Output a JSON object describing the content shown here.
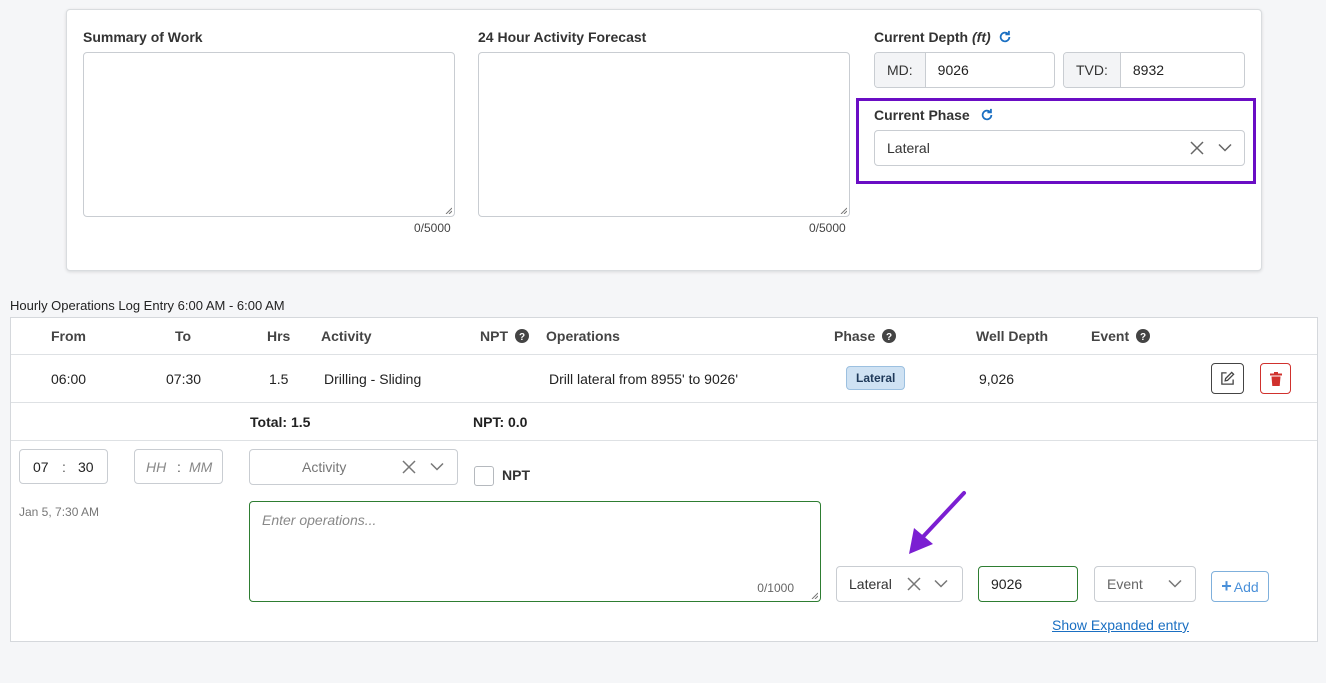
{
  "summary": {
    "label": "Summary of Work",
    "counter": "0/5000"
  },
  "forecast": {
    "label": "24 Hour Activity Forecast",
    "counter": "0/5000"
  },
  "depth": {
    "label": "Current Depth",
    "unit": "(ft)",
    "md_label": "MD:",
    "md_value": "9026",
    "tvd_label": "TVD:",
    "tvd_value": "8932"
  },
  "phase": {
    "label": "Current Phase",
    "value": "Lateral"
  },
  "log": {
    "title": "Hourly Operations Log Entry 6:00 AM - 6:00 AM",
    "headers": {
      "from": "From",
      "to": "To",
      "hrs": "Hrs",
      "activity": "Activity",
      "npt": "NPT",
      "operations": "Operations",
      "phase": "Phase",
      "well_depth": "Well Depth",
      "event": "Event"
    },
    "rows": [
      {
        "from": "06:00",
        "to": "07:30",
        "hrs": "1.5",
        "activity": "Drilling - Sliding",
        "operations": "Drill lateral from 8955' to 9026'",
        "phase": "Lateral",
        "well_depth": "9,026"
      }
    ],
    "totals": {
      "total": "Total: 1.5",
      "npt": "NPT: 0.0"
    }
  },
  "entry": {
    "from_hh": "07",
    "from_mm": "30",
    "to_hh_placeholder": "HH",
    "to_mm_placeholder": "MM",
    "separator": ":",
    "activity_placeholder": "Activity",
    "npt_label": "NPT",
    "date_label": "Jan 5, 7:30 AM",
    "operations_placeholder": "Enter operations...",
    "operations_counter": "0/1000",
    "phase_value": "Lateral",
    "depth_value": "9026",
    "event_placeholder": "Event",
    "add_label": "Add",
    "expanded_link": "Show Expanded entry"
  },
  "colors": {
    "highlight": "#6a0dc4",
    "arrow": "#7b1fd2",
    "delete": "#d0312d",
    "link": "#1a6fc2",
    "valid_border": "#2e7d32",
    "badge_bg": "#cfe2f3"
  },
  "icons": {
    "refresh": "refresh-icon",
    "clear": "close-icon",
    "dropdown": "chevron-down-icon",
    "help": "question-circle-icon",
    "edit": "edit-icon",
    "delete": "trash-icon",
    "add": "plus-icon"
  }
}
